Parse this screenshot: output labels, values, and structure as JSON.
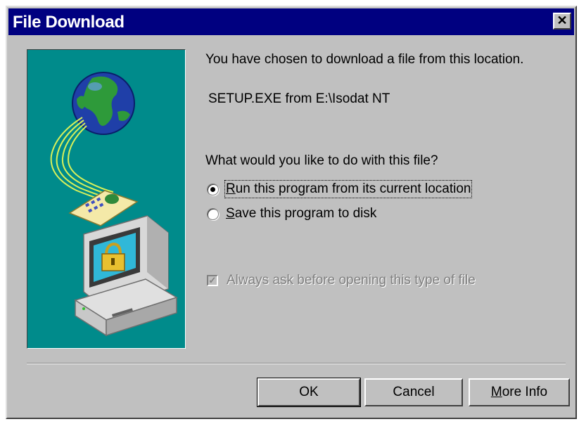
{
  "window": {
    "title": "File Download",
    "close_glyph": "✕"
  },
  "content": {
    "intro": "You have chosen to download a file from this location.",
    "file_location": "SETUP.EXE from E:\\Isodat NT",
    "question": "What would you like to do with this file?"
  },
  "options": {
    "run": {
      "label": "Run this program from its current location",
      "selected": true
    },
    "save": {
      "label": "Save this program to disk",
      "selected": false
    }
  },
  "always_ask": {
    "label": "Always ask before opening this type of file",
    "checked": true,
    "enabled": false
  },
  "buttons": {
    "ok": "OK",
    "cancel": "Cancel",
    "more_info": "More Info"
  },
  "colors": {
    "titlebar": "#000080",
    "dialog_face": "#c0c0c0",
    "art_background": "#008b8b"
  },
  "icons": {
    "art": "globe-network-computer-lock-illustration",
    "close": "close-icon"
  }
}
